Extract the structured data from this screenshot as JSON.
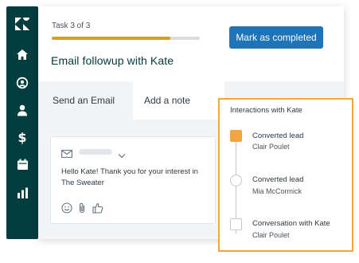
{
  "sidebar": {
    "items": [
      {
        "icon": "zendesk-logo-icon"
      },
      {
        "icon": "home-icon"
      },
      {
        "icon": "support-icon"
      },
      {
        "icon": "user-icon"
      },
      {
        "icon": "dollar-icon"
      },
      {
        "icon": "calendar-icon"
      },
      {
        "icon": "bar-chart-icon"
      }
    ],
    "background": "#033d3e"
  },
  "task": {
    "counter": "Task 3 of 3",
    "progress": 0.8,
    "title": "Email followup with Kate",
    "complete_label": "Mark as completed"
  },
  "tabs": [
    {
      "label": "Send an Email",
      "active": false
    },
    {
      "label": "Add a note",
      "active": true
    }
  ],
  "email": {
    "body": "Hello Kate! Thank you for your interest in The Sweater",
    "actions": [
      "emoji-icon",
      "paperclip-icon",
      "thumbs-up-icon"
    ]
  },
  "interactions": {
    "title": "Interactions with Kate",
    "items": [
      {
        "label": "Converted lead",
        "person": "Clair Poulet",
        "marker": "filled-square"
      },
      {
        "label": "Converted lead",
        "person": "Mia McCormick",
        "marker": "circle"
      },
      {
        "label": "Conversation with Kate",
        "person": "Clair Poulet",
        "marker": "square"
      }
    ]
  },
  "colors": {
    "accent_orange": "#f3a63f",
    "progress_gold": "#d1a317",
    "button_blue": "#1f73b7",
    "title_teal": "#03363d"
  }
}
